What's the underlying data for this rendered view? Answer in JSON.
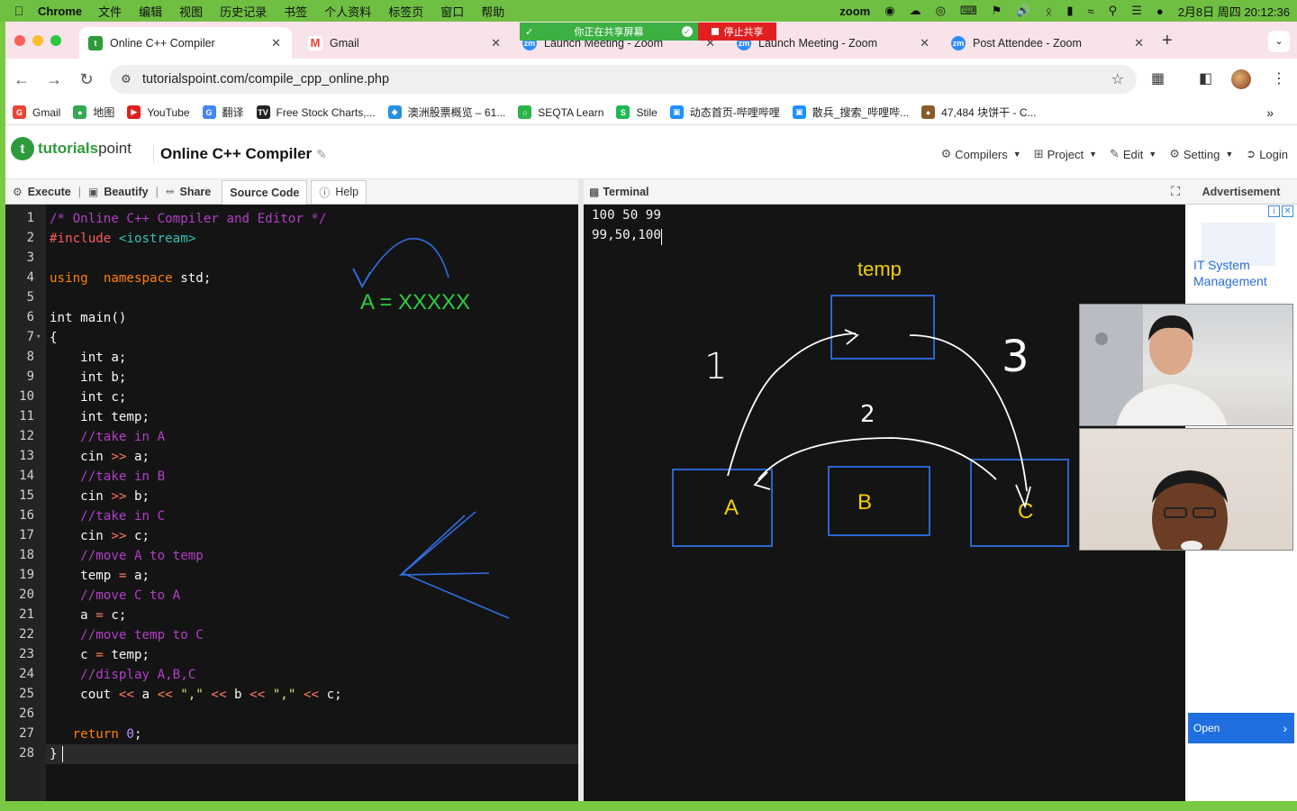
{
  "menubar": {
    "app": "Chrome",
    "items": [
      "文件",
      "编辑",
      "视图",
      "历史记录",
      "书签",
      "个人资料",
      "标签页",
      "窗口",
      "帮助"
    ],
    "clock": "2月8日 周四  20:12:36",
    "zoom_label": "zoom"
  },
  "share_banner": {
    "sharing_text": "你正在共享屏幕",
    "stop_text": "停止共享"
  },
  "tabs": [
    {
      "title": "Online C++ Compiler",
      "favicon": "tutorialspoint-icon",
      "active": true
    },
    {
      "title": "Gmail",
      "favicon": "gmail-icon",
      "active": false
    },
    {
      "title": "Launch Meeting - Zoom",
      "favicon": "zoom-icon",
      "active": false
    },
    {
      "title": "Launch Meeting - Zoom",
      "favicon": "zoom-icon",
      "active": false
    },
    {
      "title": "Post Attendee - Zoom",
      "favicon": "zoom-icon",
      "active": false
    }
  ],
  "address": {
    "url": "tutorialspoint.com/compile_cpp_online.php"
  },
  "bookmarks": [
    {
      "label": "Gmail",
      "color": "#ea4335",
      "glyph": "G"
    },
    {
      "label": "地图",
      "color": "#34a853",
      "glyph": "●"
    },
    {
      "label": "YouTube",
      "color": "#e02020",
      "glyph": "▶"
    },
    {
      "label": "翻译",
      "color": "#4285f4",
      "glyph": "G"
    },
    {
      "label": "Free Stock Charts,...",
      "color": "#222222",
      "glyph": "TV"
    },
    {
      "label": "澳洲股票概览 – 61...",
      "color": "#2a8fe0",
      "glyph": "◆"
    },
    {
      "label": "SEQTA Learn",
      "color": "#2db34a",
      "glyph": "○"
    },
    {
      "label": "Stile",
      "color": "#1db954",
      "glyph": "S"
    },
    {
      "label": "动态首页-哔哩哔哩",
      "color": "#1e90ff",
      "glyph": "▣"
    },
    {
      "label": "散兵_搜索_哔哩哔...",
      "color": "#1e90ff",
      "glyph": "▣"
    },
    {
      "label": "47,484 块饼干 - C...",
      "color": "#8b5a2b",
      "glyph": "●"
    }
  ],
  "site": {
    "logo_a": "tutorials",
    "logo_b": "point",
    "page_title": "Online C++ Compiler",
    "menu": [
      "Compilers",
      "Project",
      "Edit",
      "Setting",
      "Login"
    ]
  },
  "editor_toolbar": {
    "execute": "Execute",
    "beautify": "Beautify",
    "share": "Share",
    "source": "Source Code",
    "help": "Help"
  },
  "code_lines": [
    [
      [
        "cmt",
        "/* Online C++ Compiler and Editor */"
      ]
    ],
    [
      [
        "inc",
        "#include "
      ],
      [
        "hdr",
        "<iostream>"
      ]
    ],
    [],
    [
      [
        "kw",
        "using"
      ],
      [
        "",
        "  "
      ],
      [
        "kw",
        "namespace"
      ],
      [
        "",
        " std;"
      ]
    ],
    [],
    [
      [
        "",
        "int main()"
      ]
    ],
    [
      [
        "",
        "{"
      ]
    ],
    [
      [
        "",
        "    int a;"
      ]
    ],
    [
      [
        "",
        "    int b;"
      ]
    ],
    [
      [
        "",
        "    int c;"
      ]
    ],
    [
      [
        "",
        "    int temp;"
      ]
    ],
    [
      [
        "cmt",
        "    //take in A"
      ]
    ],
    [
      [
        "",
        "    cin "
      ],
      [
        "op",
        ">>"
      ],
      [
        "",
        " a;"
      ]
    ],
    [
      [
        "cmt",
        "    //take in B"
      ]
    ],
    [
      [
        "",
        "    cin "
      ],
      [
        "op",
        ">>"
      ],
      [
        "",
        " b;"
      ]
    ],
    [
      [
        "cmt",
        "    //take in C"
      ]
    ],
    [
      [
        "",
        "    cin "
      ],
      [
        "op",
        ">>"
      ],
      [
        "",
        " c;"
      ]
    ],
    [
      [
        "cmt",
        "    //move A to temp"
      ]
    ],
    [
      [
        "",
        "    temp "
      ],
      [
        "op",
        "="
      ],
      [
        "",
        " a;"
      ]
    ],
    [
      [
        "cmt",
        "    //move C to A"
      ]
    ],
    [
      [
        "",
        "    a "
      ],
      [
        "op",
        "="
      ],
      [
        "",
        " c;"
      ]
    ],
    [
      [
        "cmt",
        "    //move temp to C"
      ]
    ],
    [
      [
        "",
        "    c "
      ],
      [
        "op",
        "="
      ],
      [
        "",
        " temp;"
      ]
    ],
    [
      [
        "cmt",
        "    //display A,B,C"
      ]
    ],
    [
      [
        "",
        "    cout "
      ],
      [
        "op",
        "<<"
      ],
      [
        "",
        " a "
      ],
      [
        "op",
        "<<"
      ],
      [
        "",
        ""
      ],
      [
        "str",
        " \",\""
      ],
      [
        "",
        " "
      ],
      [
        "op",
        "<<"
      ],
      [
        "",
        " b "
      ],
      [
        "op",
        "<<"
      ],
      [
        "str",
        " \",\""
      ],
      [
        "",
        " "
      ],
      [
        "op",
        "<<"
      ],
      [
        "",
        " c;"
      ]
    ],
    [],
    [
      [
        "",
        "   "
      ],
      [
        "kw",
        "return"
      ],
      [
        "",
        " "
      ],
      [
        "num",
        "0"
      ],
      [
        "",
        ";"
      ]
    ],
    [
      [
        "",
        "}"
      ]
    ]
  ],
  "terminal": {
    "title": "Terminal",
    "lines": [
      "100 50 99",
      "99,50,100"
    ]
  },
  "annotations": {
    "note_a": "A = XXXXX",
    "temp": "temp",
    "A": "A",
    "B": "B",
    "C": "C",
    "n1": "1",
    "n2": "2",
    "n3": "3",
    "accent_green": "#2ecc40",
    "accent_yellow": "#f5d000",
    "box_blue": "#2f6ee0"
  },
  "ad": {
    "header": "Advertisement",
    "text": "IT System Management",
    "button": "Open"
  }
}
